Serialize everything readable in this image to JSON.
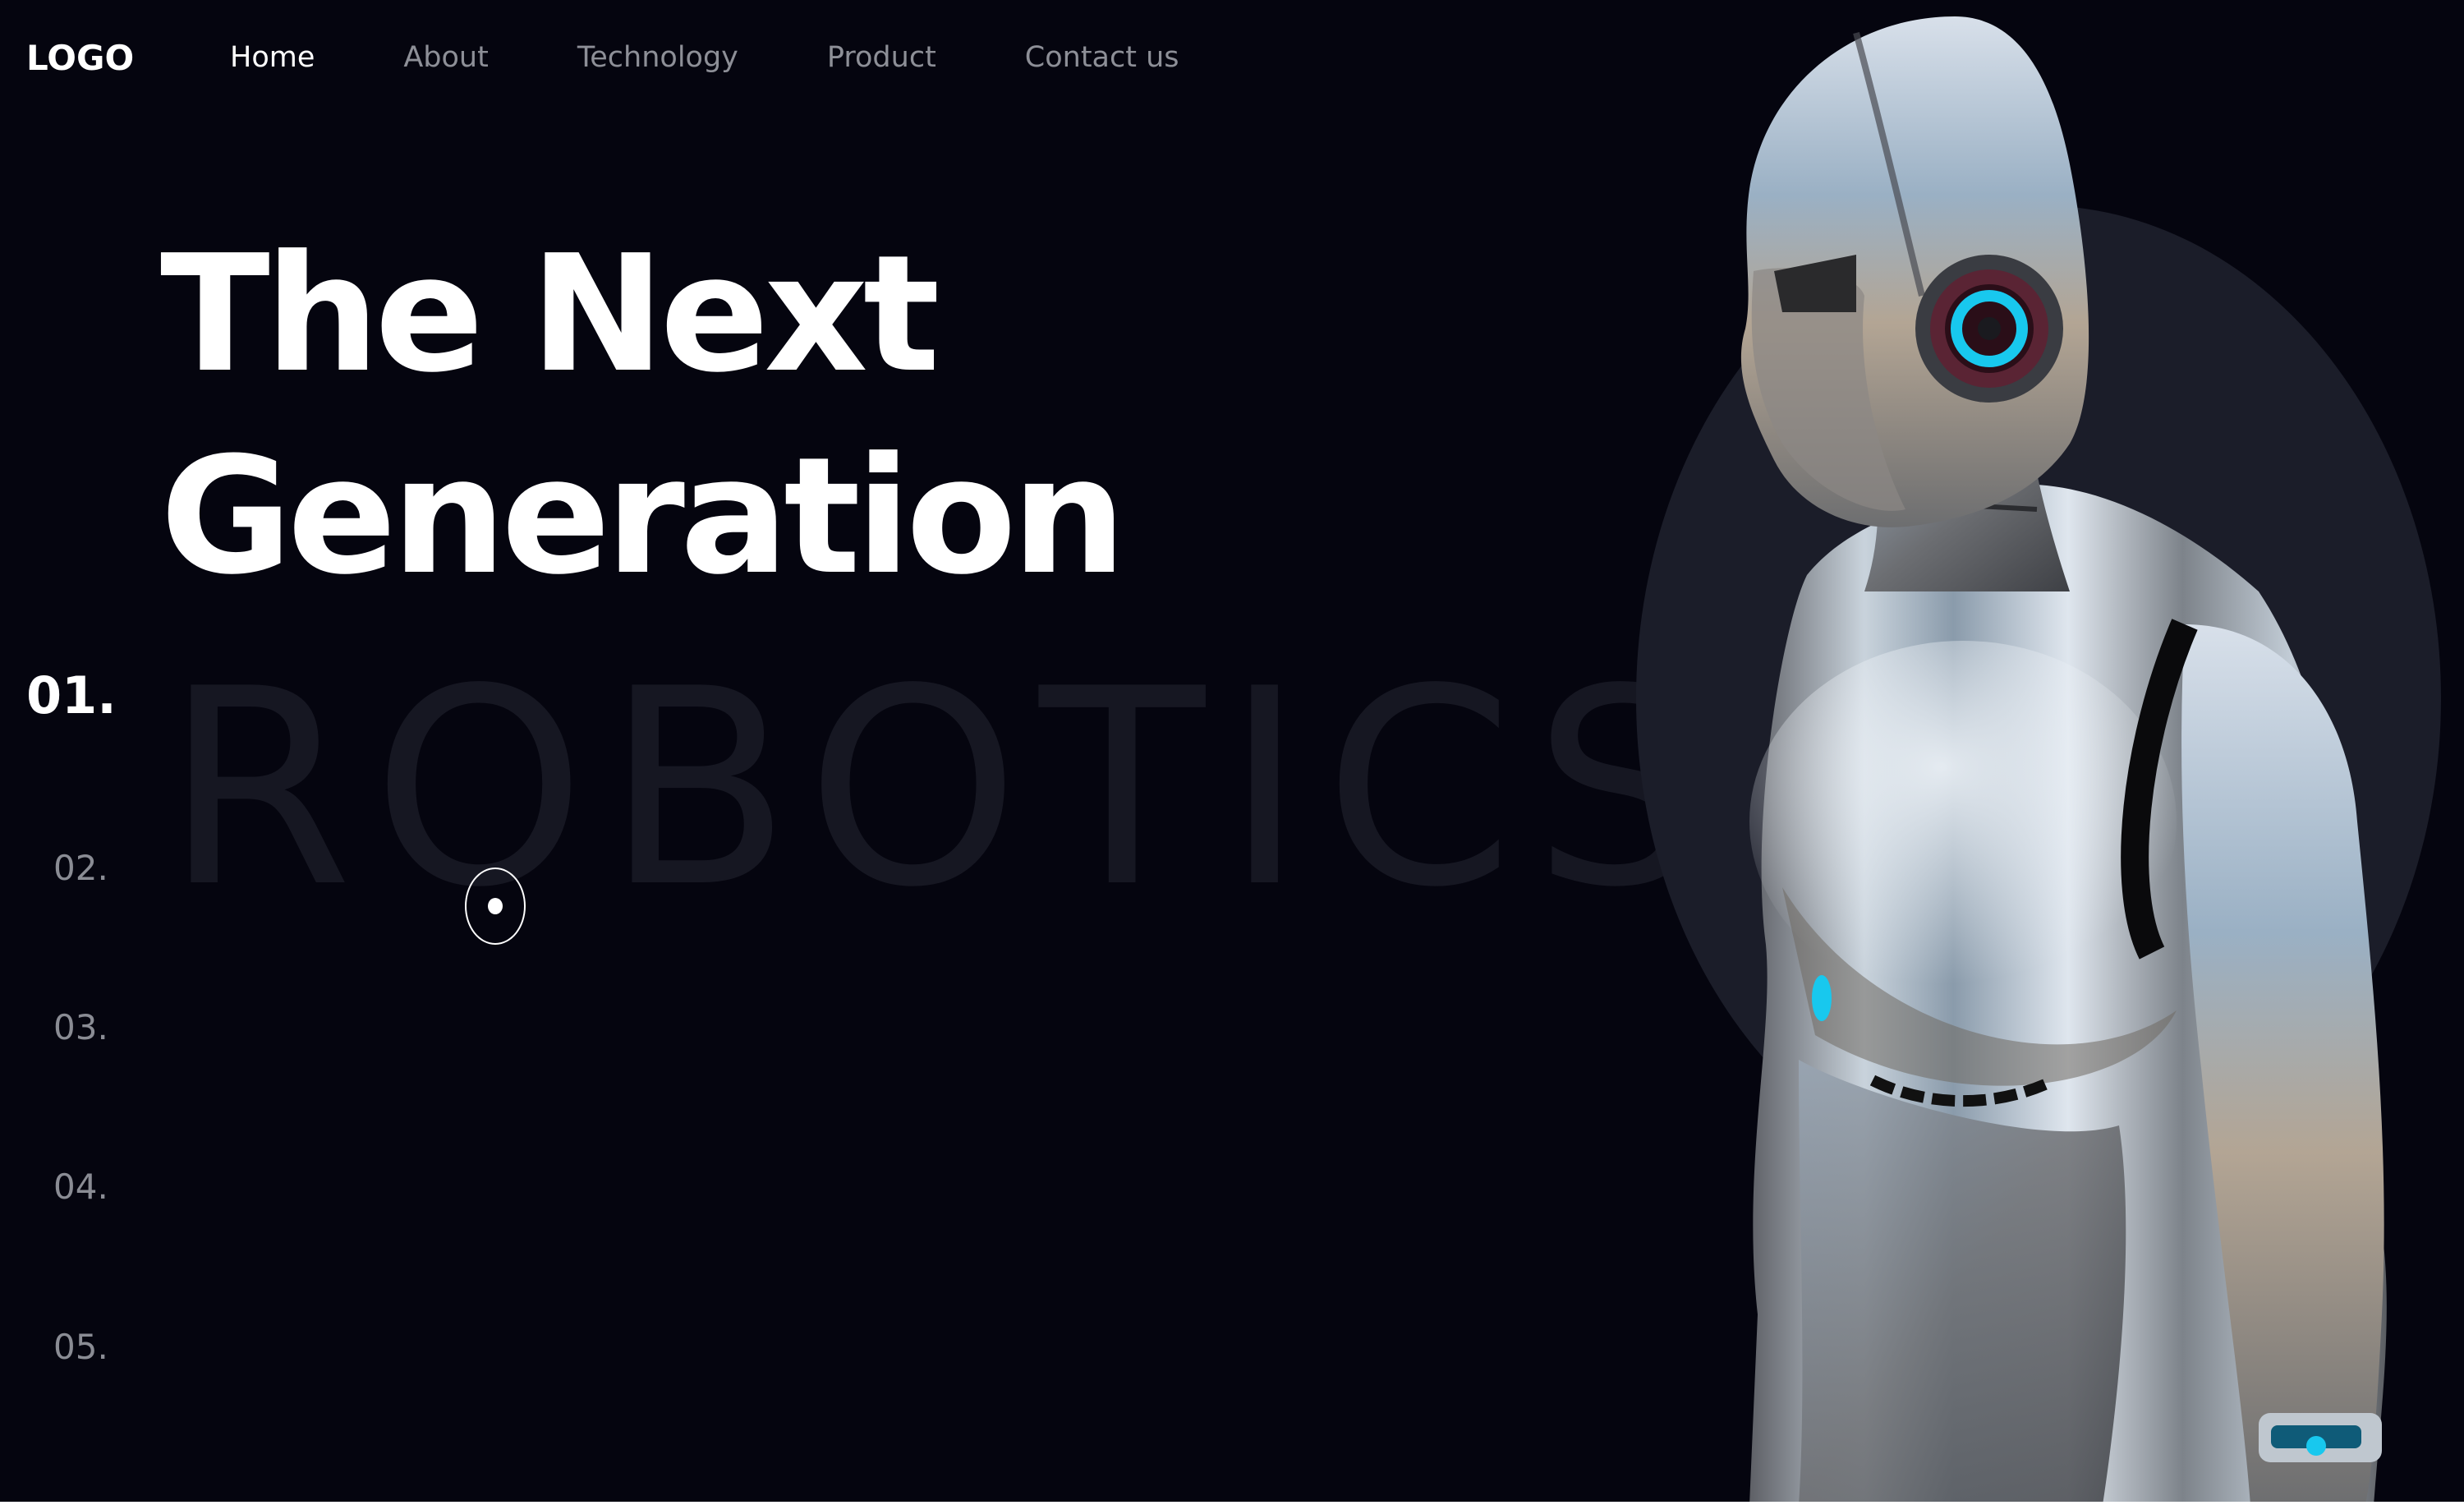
{
  "header": {
    "logo": "LOGO",
    "nav": [
      {
        "label": "Home",
        "active": true
      },
      {
        "label": "About",
        "active": false
      },
      {
        "label": "Technology",
        "active": false
      },
      {
        "label": "Product",
        "active": false
      },
      {
        "label": "Contact us",
        "active": false
      }
    ]
  },
  "hero": {
    "title_line1": "The Next",
    "title_line2": "Generation",
    "background_word": "ROBOTICS",
    "image": "chrome-humanoid-robot-profile"
  },
  "slides": {
    "active": "01.",
    "items": [
      "01.",
      "02.",
      "03.",
      "04.",
      "05."
    ]
  },
  "colors": {
    "background": "#05050f",
    "text": "#ffffff",
    "muted": "#8a8c94",
    "ghost": "#161722",
    "circle": "#1b1d29",
    "accent_cyan": "#18c8ee"
  }
}
